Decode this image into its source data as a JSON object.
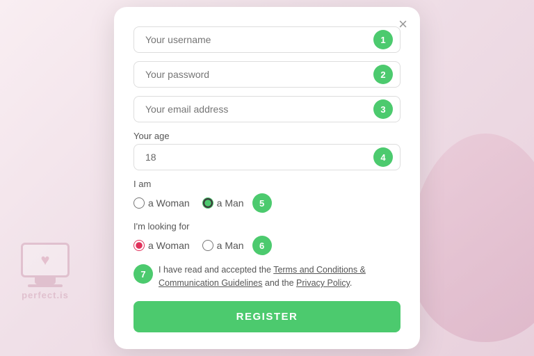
{
  "modal": {
    "close_label": "×",
    "fields": {
      "username": {
        "placeholder": "Your username",
        "step": "1"
      },
      "password": {
        "placeholder": "Your password",
        "step": "2"
      },
      "email": {
        "placeholder": "Your email address",
        "step": "3"
      },
      "age": {
        "label": "Your age",
        "value": "18",
        "step": "4"
      }
    },
    "i_am": {
      "label": "I am",
      "options": [
        {
          "id": "iam-woman",
          "label": "a Woman",
          "checked": false
        },
        {
          "id": "iam-man",
          "label": "a Man",
          "checked": true
        }
      ],
      "step": "5"
    },
    "looking_for": {
      "label": "I'm looking for",
      "options": [
        {
          "id": "look-woman",
          "label": "a Woman",
          "checked": true
        },
        {
          "id": "look-man",
          "label": "a Man",
          "checked": false
        }
      ],
      "step": "6"
    },
    "terms": {
      "step": "7",
      "text_before": "I have read and accepted the ",
      "link1_text": "Terms and Conditions & Communication Guidelines",
      "text_middle": " and the ",
      "link2_text": "Privacy Policy",
      "text_after": "."
    },
    "register_button": "REGISTER"
  },
  "watermark": {
    "text": "perfect.is"
  }
}
